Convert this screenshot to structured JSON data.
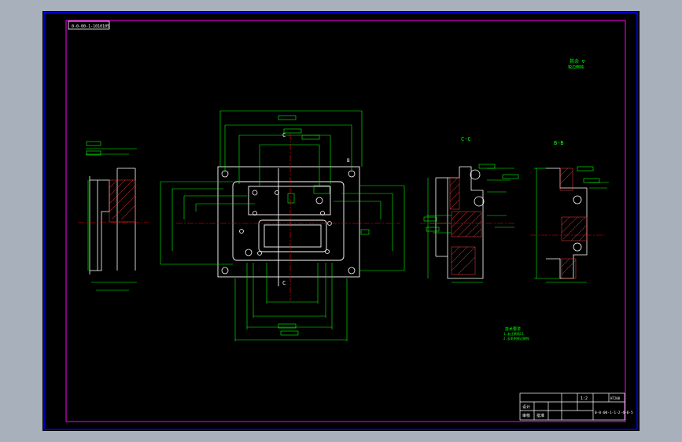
{
  "window": {
    "background_color": "#a8b0bb",
    "canvas_color": "#000000"
  },
  "colors": {
    "outer_frame": "#0000ff",
    "inner_frame": "#ff00ff",
    "geometry": "#ffffff",
    "dimension": "#00ff00",
    "centerline": "#ff0000",
    "hatch": "#ff3f3f"
  },
  "drawing": {
    "header_box_text": "0-0-00-1-1010105",
    "note_top_right_line1": "其余 ∇",
    "note_top_right_line2": "锐边倒钝",
    "section_cc": "C-C",
    "section_bb": "B-B",
    "cut_label_c_top": "C",
    "cut_label_c_bottom": "C",
    "cut_label_b": "B",
    "technical_requirements_title": "技术要求",
    "technical_requirements_1": "1.未注倒角C1",
    "technical_requirements_2": "2.去毛刺锐边倒钝"
  },
  "title_block": {
    "scale": "1:2",
    "material": "HT200",
    "part_code": "0-0-00-1-1-2-4-0-5",
    "label_design": "设计",
    "label_check": "审核",
    "label_approve": "批准"
  }
}
